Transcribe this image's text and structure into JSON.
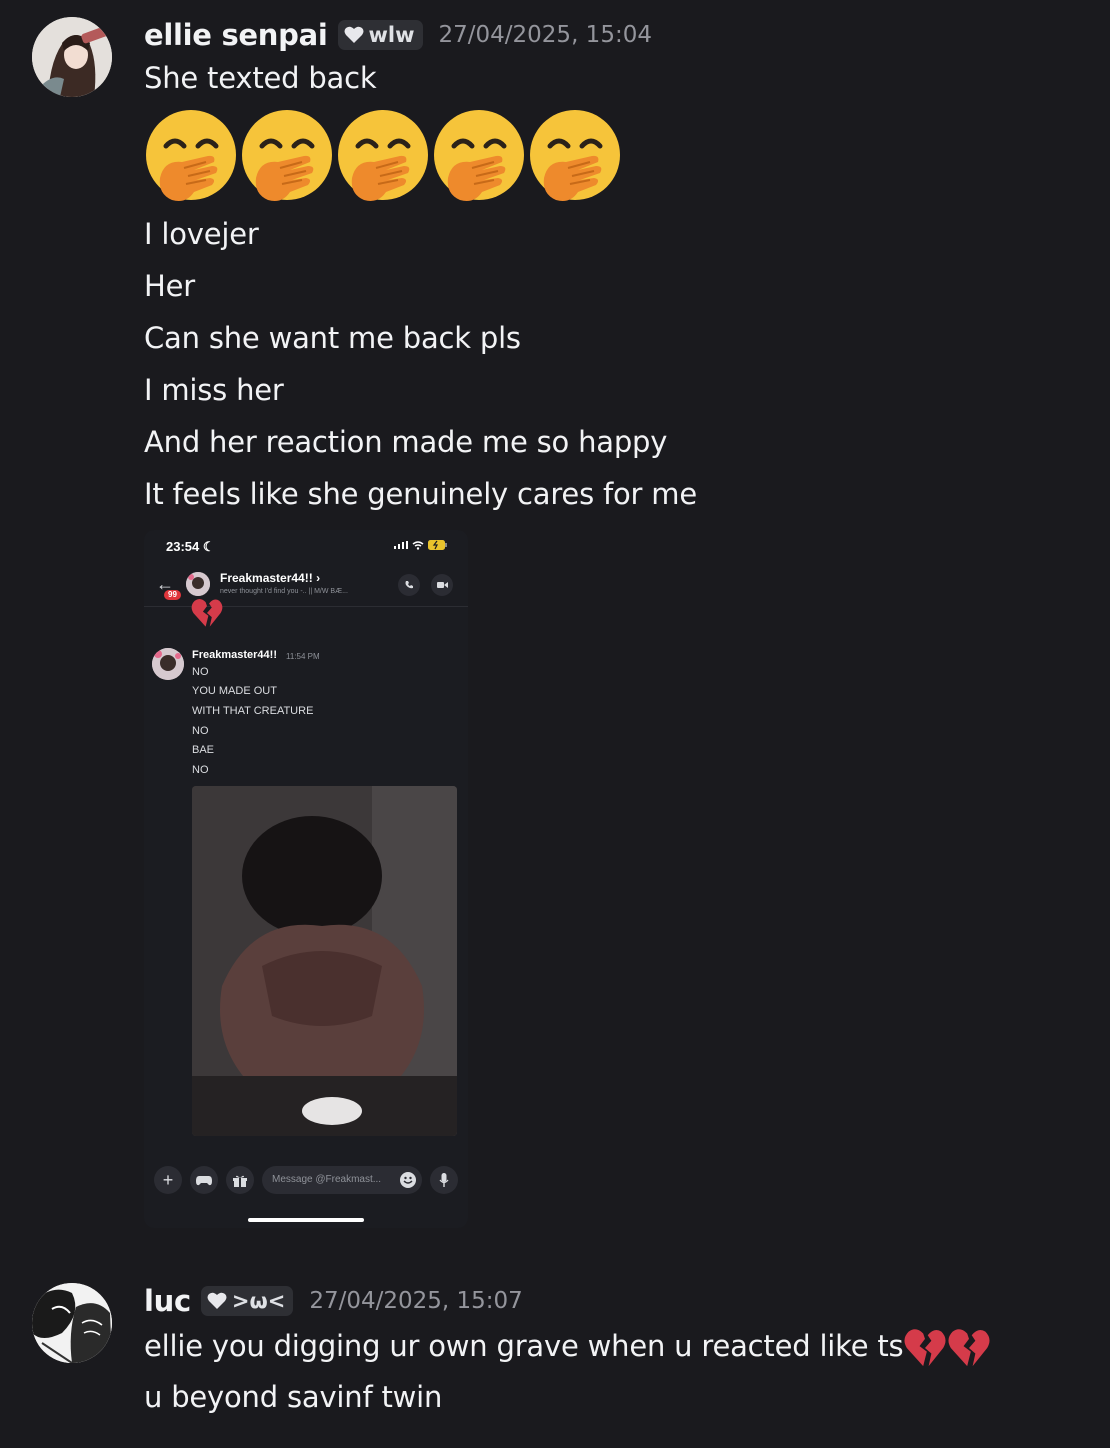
{
  "messages": [
    {
      "username": "ellie senpai",
      "tag": "wlw",
      "timestamp": "27/04/2025, 15:04",
      "lines": [
        "She texted back",
        "I lovejer",
        "Her",
        "Can she want me back pls",
        "I miss her",
        "And her reaction made me so happy",
        "It feels like she genuinely cares for me"
      ],
      "emoji": "face-with-hand-over-mouth",
      "emoji_count": 5,
      "attachment": {
        "status_time": "23:54",
        "dm_name": "Freakmaster44!!",
        "dm_subtitle": "never thought I'd find you -.. || M/W BÆ...",
        "badge": "99",
        "author": "Freakmaster44!!",
        "time": "11:54 PM",
        "lines": [
          "NO",
          "YOU MADE OUT",
          "WITH THAT CREATURE",
          "NO",
          "BAE",
          "NO"
        ],
        "input_placeholder": "Message @Freakmast..."
      }
    },
    {
      "username": "luc",
      "tag": ">ω<",
      "timestamp": "27/04/2025, 15:07",
      "lines": [
        "ellie you digging ur own grave when u reacted like ts",
        "u beyond savinf twin"
      ],
      "inline_emoji": "broken-heart",
      "inline_emoji_count": 2
    }
  ],
  "colors": {
    "background": "#1a1a1e",
    "text": "#f2f3f5",
    "muted": "#94959c",
    "tag_bg": "#2e2f34"
  }
}
